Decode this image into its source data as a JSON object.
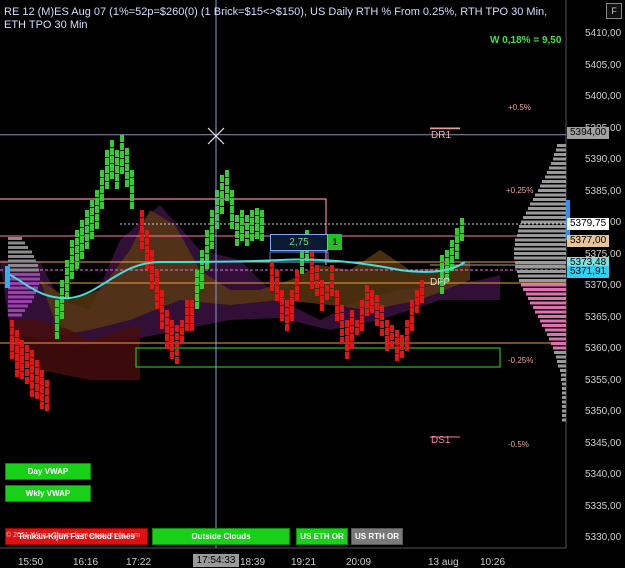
{
  "header": {
    "title": "RE 12 (M)ES Aug 07 (1%=52p=$260(0) (1 Brick=$15<>$150), US Daily RTH % From 0.25%, RTH TPO 30 Min, ETH TPO 30 Min",
    "w_readout": "W 0,18% = 9,50",
    "corner_button": "F"
  },
  "price_axis": {
    "ticks": [
      "5410,00",
      "5405,00",
      "5400,00",
      "5395,00",
      "5390,00",
      "5385,00",
      "5380,00",
      "5375,00",
      "5370,00",
      "5365,00",
      "5360,00",
      "5355,00",
      "5350,00",
      "5345,00",
      "5340,00",
      "5335,00",
      "5330,00"
    ],
    "tags": [
      {
        "text": "5394,00",
        "color": "#a0a0a0"
      },
      {
        "text": "5379,75",
        "color": "#ffffff"
      },
      {
        "text": "5377,00",
        "color": "#e8c49a"
      },
      {
        "text": "5373,48",
        "color": "#7fe0e0"
      },
      {
        "text": "5371,91",
        "color": "#2fd0f0"
      }
    ]
  },
  "time_axis": {
    "labels": [
      "15:50",
      "16:16",
      "17:22",
      "18:39",
      "19:21",
      "20:09",
      "13 aug",
      "10:26"
    ],
    "cursor_time": "17:54:33"
  },
  "levels": {
    "pos_05": "+0.5%",
    "pos_025": "+0.25%",
    "neg_025": "-0.25%",
    "neg_05": "-0.5%",
    "dr1": "DR1",
    "ds1": "DS1",
    "dfp": "DFP"
  },
  "annotations": {
    "box_value": "2,75",
    "badge": "1"
  },
  "buttons": {
    "day_vwap": "Day VWAP",
    "wkly_vwap": "Wkly VWAP",
    "tenkan_kijun": "Tenkan-Kijun Fast Cloud Lines",
    "outside_clouds": "Outside Clouds",
    "us_eth_or": "US ETH OR",
    "us_rth_or": "US RTH OR"
  },
  "watermark": "© 2021 Wingz Charts from www.nt-alg.com",
  "colors": {
    "up_brick": "#33cc33",
    "down_brick": "#e01515",
    "vwap": "#40e0e0",
    "profile": "#9a9a9a",
    "profile_low": "#e070b0"
  }
}
